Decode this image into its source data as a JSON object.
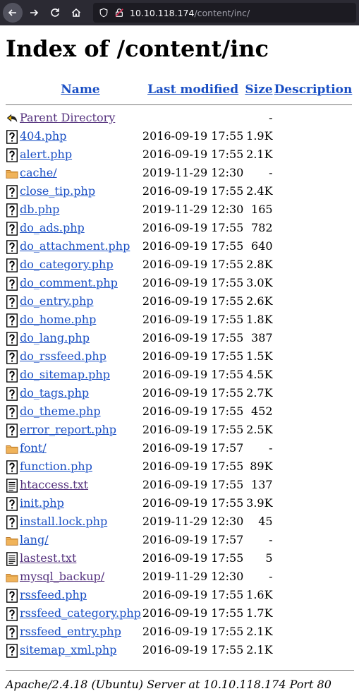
{
  "browser": {
    "url_host": "10.10.118.174",
    "url_path": "/content/inc/"
  },
  "page": {
    "title": "Index of /content/inc",
    "columns": {
      "name": "Name",
      "modified": "Last modified",
      "size": "Size",
      "description": "Description"
    },
    "footer": "Apache/2.4.18 (Ubuntu) Server at 10.10.118.174 Port 80"
  },
  "entries": [
    {
      "icon": "back-icon",
      "name": "Parent Directory",
      "modified": "",
      "size": "-",
      "visited": true
    },
    {
      "icon": "unknown-file-icon",
      "name": "404.php",
      "modified": "2016-09-19 17:55",
      "size": "1.9K"
    },
    {
      "icon": "unknown-file-icon",
      "name": "alert.php",
      "modified": "2016-09-19 17:55",
      "size": "2.1K"
    },
    {
      "icon": "folder-icon",
      "name": "cache/",
      "modified": "2019-11-29 12:30",
      "size": "-"
    },
    {
      "icon": "unknown-file-icon",
      "name": "close_tip.php",
      "modified": "2016-09-19 17:55",
      "size": "2.4K"
    },
    {
      "icon": "unknown-file-icon",
      "name": "db.php",
      "modified": "2019-11-29 12:30",
      "size": "165"
    },
    {
      "icon": "unknown-file-icon",
      "name": "do_ads.php",
      "modified": "2016-09-19 17:55",
      "size": "782"
    },
    {
      "icon": "unknown-file-icon",
      "name": "do_attachment.php",
      "modified": "2016-09-19 17:55",
      "size": "640"
    },
    {
      "icon": "unknown-file-icon",
      "name": "do_category.php",
      "modified": "2016-09-19 17:55",
      "size": "2.8K"
    },
    {
      "icon": "unknown-file-icon",
      "name": "do_comment.php",
      "modified": "2016-09-19 17:55",
      "size": "3.0K"
    },
    {
      "icon": "unknown-file-icon",
      "name": "do_entry.php",
      "modified": "2016-09-19 17:55",
      "size": "2.6K"
    },
    {
      "icon": "unknown-file-icon",
      "name": "do_home.php",
      "modified": "2016-09-19 17:55",
      "size": "1.8K"
    },
    {
      "icon": "unknown-file-icon",
      "name": "do_lang.php",
      "modified": "2016-09-19 17:55",
      "size": "387"
    },
    {
      "icon": "unknown-file-icon",
      "name": "do_rssfeed.php",
      "modified": "2016-09-19 17:55",
      "size": "1.5K"
    },
    {
      "icon": "unknown-file-icon",
      "name": "do_sitemap.php",
      "modified": "2016-09-19 17:55",
      "size": "4.5K"
    },
    {
      "icon": "unknown-file-icon",
      "name": "do_tags.php",
      "modified": "2016-09-19 17:55",
      "size": "2.7K"
    },
    {
      "icon": "unknown-file-icon",
      "name": "do_theme.php",
      "modified": "2016-09-19 17:55",
      "size": "452"
    },
    {
      "icon": "unknown-file-icon",
      "name": "error_report.php",
      "modified": "2016-09-19 17:55",
      "size": "2.5K"
    },
    {
      "icon": "folder-icon",
      "name": "font/",
      "modified": "2016-09-19 17:57",
      "size": "-"
    },
    {
      "icon": "unknown-file-icon",
      "name": "function.php",
      "modified": "2016-09-19 17:55",
      "size": "89K"
    },
    {
      "icon": "text-file-icon",
      "name": "htaccess.txt",
      "modified": "2016-09-19 17:55",
      "size": "137",
      "visited": true
    },
    {
      "icon": "unknown-file-icon",
      "name": "init.php",
      "modified": "2016-09-19 17:55",
      "size": "3.9K"
    },
    {
      "icon": "unknown-file-icon",
      "name": "install.lock.php",
      "modified": "2019-11-29 12:30",
      "size": "45"
    },
    {
      "icon": "folder-icon",
      "name": "lang/",
      "modified": "2016-09-19 17:57",
      "size": "-"
    },
    {
      "icon": "text-file-icon",
      "name": "lastest.txt",
      "modified": "2016-09-19 17:55",
      "size": "5",
      "visited": true
    },
    {
      "icon": "folder-icon",
      "name": "mysql_backup/",
      "modified": "2019-11-29 12:30",
      "size": "-",
      "visited": true
    },
    {
      "icon": "unknown-file-icon",
      "name": "rssfeed.php",
      "modified": "2016-09-19 17:55",
      "size": "1.6K"
    },
    {
      "icon": "unknown-file-icon",
      "name": "rssfeed_category.php",
      "modified": "2016-09-19 17:55",
      "size": "1.7K"
    },
    {
      "icon": "unknown-file-icon",
      "name": "rssfeed_entry.php",
      "modified": "2016-09-19 17:55",
      "size": "2.1K"
    },
    {
      "icon": "unknown-file-icon",
      "name": "sitemap_xml.php",
      "modified": "2016-09-19 17:55",
      "size": "2.1K"
    }
  ]
}
